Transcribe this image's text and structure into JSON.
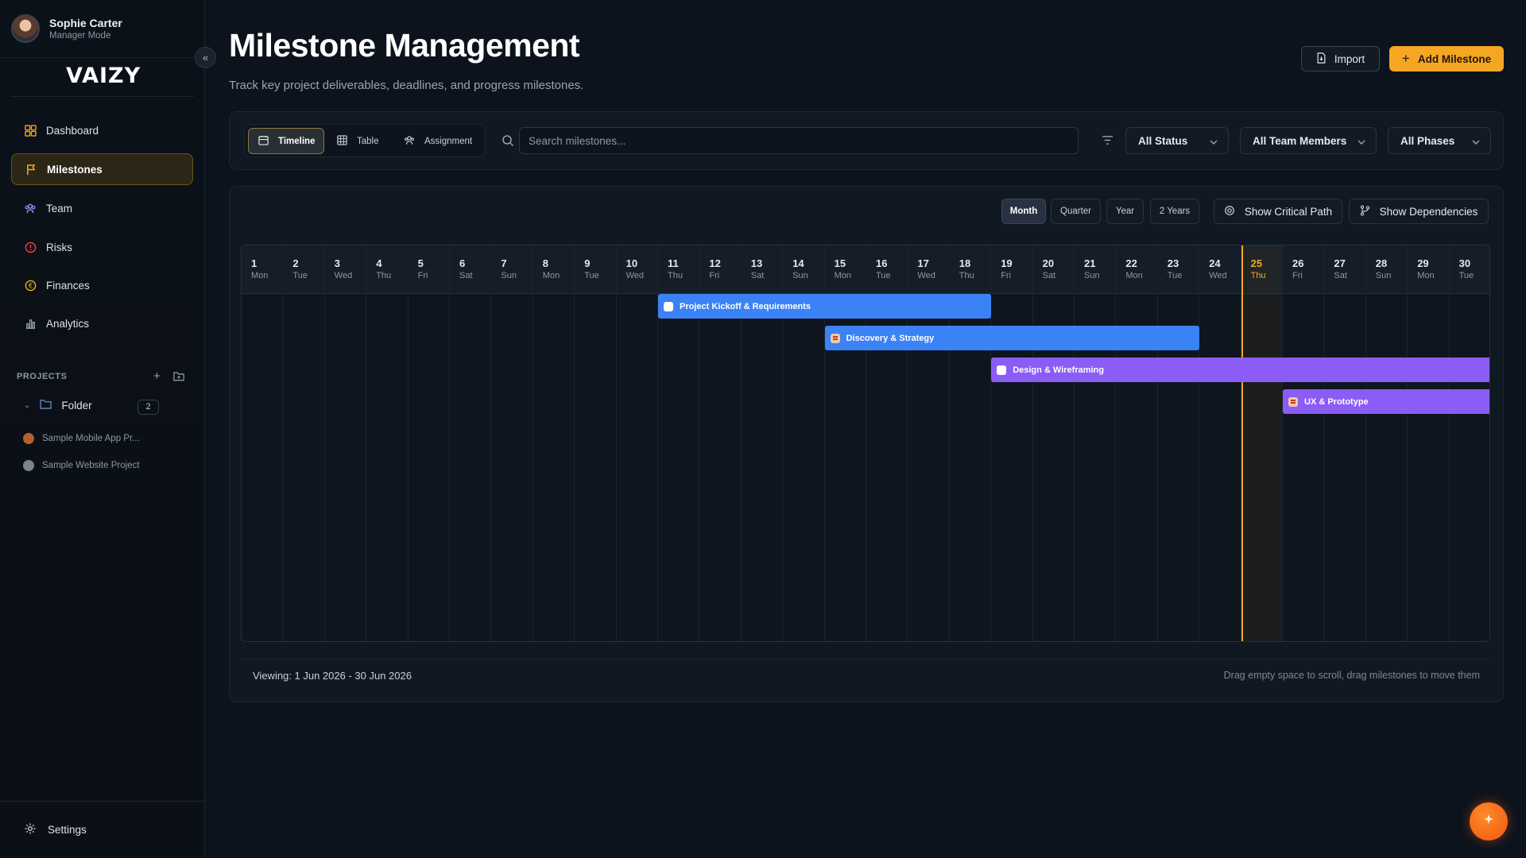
{
  "user": {
    "name": "Sophie Carter",
    "mode": "Manager Mode"
  },
  "logo": "VAIZY",
  "sidebar": {
    "items": [
      {
        "label": "Dashboard",
        "icon": "dashboard-icon"
      },
      {
        "label": "Milestones",
        "icon": "flag-icon",
        "active": true
      },
      {
        "label": "Team",
        "icon": "team-icon"
      },
      {
        "label": "Risks",
        "icon": "alert-icon"
      },
      {
        "label": "Finances",
        "icon": "coin-icon"
      },
      {
        "label": "Analytics",
        "icon": "bar-chart-icon"
      }
    ],
    "projects_label": "PROJECTS",
    "folder": {
      "label": "Folder",
      "count": "2"
    },
    "projects": [
      {
        "label": "Sample Mobile App Pr...",
        "color": "#b5602a"
      },
      {
        "label": "Sample Website Project",
        "color": "#7a8490"
      }
    ],
    "settings_label": "Settings"
  },
  "header": {
    "title": "Milestone Management",
    "subtitle": "Track key project deliverables, deadlines, and progress milestones.",
    "import_label": "Import",
    "add_label": "Add Milestone"
  },
  "toolbar": {
    "tabs": [
      {
        "label": "Timeline",
        "active": true
      },
      {
        "label": "Table"
      },
      {
        "label": "Assignment"
      }
    ],
    "search_placeholder": "Search milestones...",
    "filters": [
      "All Status",
      "All Team Members",
      "All Phases"
    ]
  },
  "timeline": {
    "ranges": [
      {
        "label": "Month",
        "active": true
      },
      {
        "label": "Quarter"
      },
      {
        "label": "Year"
      },
      {
        "label": "2 Years"
      }
    ],
    "critical_path_label": "Show Critical Path",
    "dependencies_label": "Show Dependencies",
    "days": [
      {
        "d": "1",
        "w": "Mon"
      },
      {
        "d": "2",
        "w": "Tue"
      },
      {
        "d": "3",
        "w": "Wed"
      },
      {
        "d": "4",
        "w": "Thu"
      },
      {
        "d": "5",
        "w": "Fri"
      },
      {
        "d": "6",
        "w": "Sat"
      },
      {
        "d": "7",
        "w": "Sun"
      },
      {
        "d": "8",
        "w": "Mon"
      },
      {
        "d": "9",
        "w": "Tue"
      },
      {
        "d": "10",
        "w": "Wed"
      },
      {
        "d": "11",
        "w": "Thu"
      },
      {
        "d": "12",
        "w": "Fri"
      },
      {
        "d": "13",
        "w": "Sat"
      },
      {
        "d": "14",
        "w": "Sun"
      },
      {
        "d": "15",
        "w": "Mon"
      },
      {
        "d": "16",
        "w": "Tue"
      },
      {
        "d": "17",
        "w": "Wed"
      },
      {
        "d": "18",
        "w": "Thu"
      },
      {
        "d": "19",
        "w": "Fri"
      },
      {
        "d": "20",
        "w": "Sat"
      },
      {
        "d": "21",
        "w": "Sun"
      },
      {
        "d": "22",
        "w": "Mon"
      },
      {
        "d": "23",
        "w": "Tue"
      },
      {
        "d": "24",
        "w": "Wed"
      },
      {
        "d": "25",
        "w": "Thu"
      },
      {
        "d": "26",
        "w": "Fri"
      },
      {
        "d": "27",
        "w": "Sat"
      },
      {
        "d": "28",
        "w": "Sun"
      },
      {
        "d": "29",
        "w": "Mon"
      },
      {
        "d": "30",
        "w": "Tue"
      }
    ],
    "today": "25",
    "milestones": [
      {
        "label": "Project Kickoff & Requirements",
        "start": 11,
        "end": 18,
        "color": "#3b82f6",
        "marker": "check"
      },
      {
        "label": "Discovery & Strategy",
        "start": 15,
        "end": 23,
        "color": "#3b82f6",
        "marker": "flag"
      },
      {
        "label": "Design & Wireframing",
        "start": 19,
        "end": 30,
        "color": "#8b5cf6",
        "marker": "check"
      },
      {
        "label": "UX & Prototype",
        "start": 26,
        "end": 30,
        "color": "#8b5cf6",
        "marker": "flag"
      }
    ],
    "viewing_text": "Viewing: 1 Jun 2026 - 30 Jun 2026",
    "hint_text": "Drag empty space to scroll, drag milestones to move them"
  },
  "colors": {
    "accent": "#f5a623",
    "blue": "#3b82f6",
    "purple": "#8b5cf6"
  }
}
